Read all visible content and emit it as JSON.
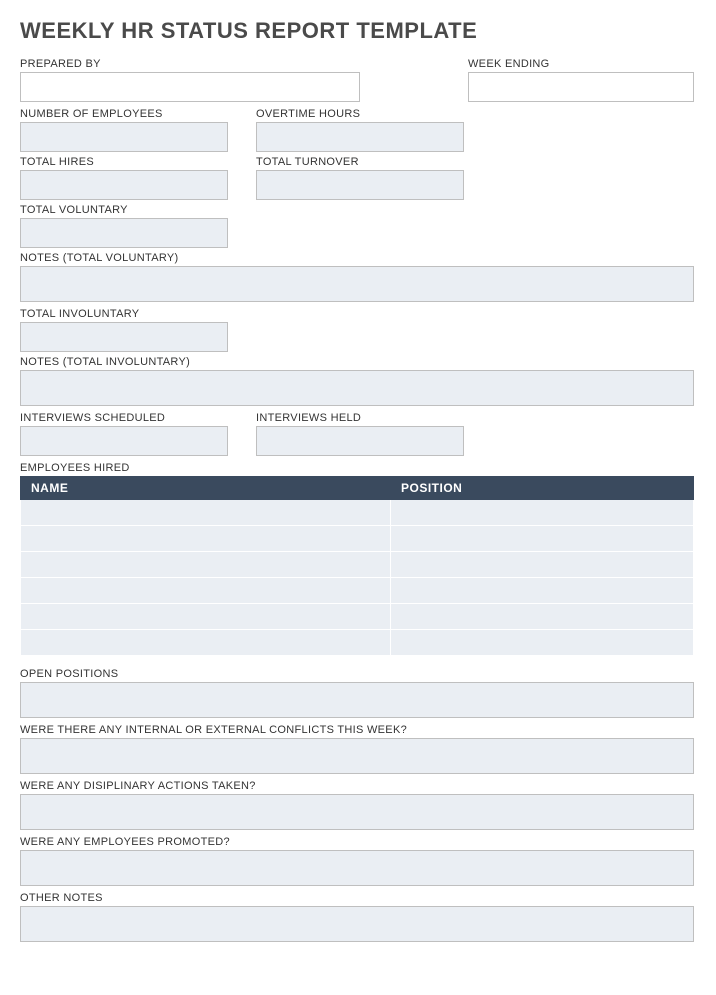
{
  "title": "WEEKLY HR STATUS REPORT TEMPLATE",
  "labels": {
    "prepared_by": "PREPARED BY",
    "week_ending": "WEEK ENDING",
    "num_employees": "NUMBER OF EMPLOYEES",
    "overtime_hours": "OVERTIME HOURS",
    "total_hires": "TOTAL HIRES",
    "total_turnover": "TOTAL TURNOVER",
    "total_voluntary": "TOTAL VOLUNTARY",
    "notes_voluntary": "NOTES (TOTAL VOLUNTARY)",
    "total_involuntary": "TOTAL INVOLUNTARY",
    "notes_involuntary": "NOTES (TOTAL INVOLUNTARY)",
    "interviews_scheduled": "INTERVIEWS SCHEDULED",
    "interviews_held": "INTERVIEWS HELD",
    "employees_hired": "EMPLOYEES HIRED",
    "open_positions": "OPEN POSITIONS",
    "conflicts": "WERE THERE ANY INTERNAL OR EXTERNAL CONFLICTS THIS WEEK?",
    "disciplinary": "WERE ANY DISIPLINARY ACTIONS TAKEN?",
    "promoted": "WERE ANY EMPLOYEES PROMOTED?",
    "other_notes": "OTHER NOTES"
  },
  "table_headers": {
    "name": "NAME",
    "position": "POSITION"
  },
  "values": {
    "prepared_by": "",
    "week_ending": "",
    "num_employees": "",
    "overtime_hours": "",
    "total_hires": "",
    "total_turnover": "",
    "total_voluntary": "",
    "notes_voluntary": "",
    "total_involuntary": "",
    "notes_involuntary": "",
    "interviews_scheduled": "",
    "interviews_held": "",
    "open_positions": "",
    "conflicts": "",
    "disciplinary": "",
    "promoted": "",
    "other_notes": ""
  },
  "employees_hired_rows": [
    {
      "name": "",
      "position": ""
    },
    {
      "name": "",
      "position": ""
    },
    {
      "name": "",
      "position": ""
    },
    {
      "name": "",
      "position": ""
    },
    {
      "name": "",
      "position": ""
    },
    {
      "name": "",
      "position": ""
    }
  ]
}
